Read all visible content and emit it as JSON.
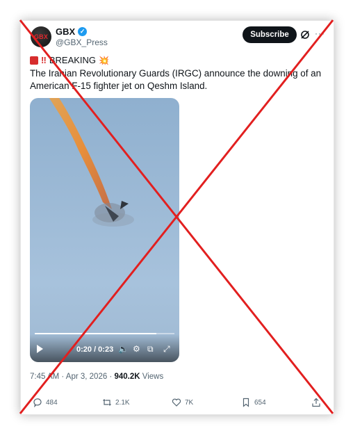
{
  "post": {
    "avatar_text": "GBX",
    "display_name": "GBX",
    "handle": "@GBX_Press",
    "subscribe_label": "Subscribe",
    "breaking_label": "BREAKING",
    "body": "The Iranian Revolutionary Guards (IRGC) announce the downing of an American F-15 fighter jet on Qeshm Island.",
    "timestamp": "7:45 AM · Apr 3, 2026 · ",
    "views_count": "940.2K",
    "views_label": " Views"
  },
  "video": {
    "time": "0:20 / 0:23",
    "progress": 0.87
  },
  "actions": {
    "replies": "484",
    "reposts": "2.1K",
    "likes": "7K",
    "bookmarks": "654"
  },
  "icons": [
    "verified-icon",
    "grok-icon",
    "more-icon",
    "siren-emoji",
    "explosion-emoji",
    "play-icon",
    "volume-icon",
    "settings-icon",
    "pip-icon",
    "fullscreen-icon",
    "reply-icon",
    "repost-icon",
    "like-icon",
    "bookmark-icon",
    "share-icon"
  ],
  "colors": {
    "accent": "#1d9bf0",
    "overlay_cross": "#e21f1f",
    "subscribe_bg": "#0f1419"
  }
}
